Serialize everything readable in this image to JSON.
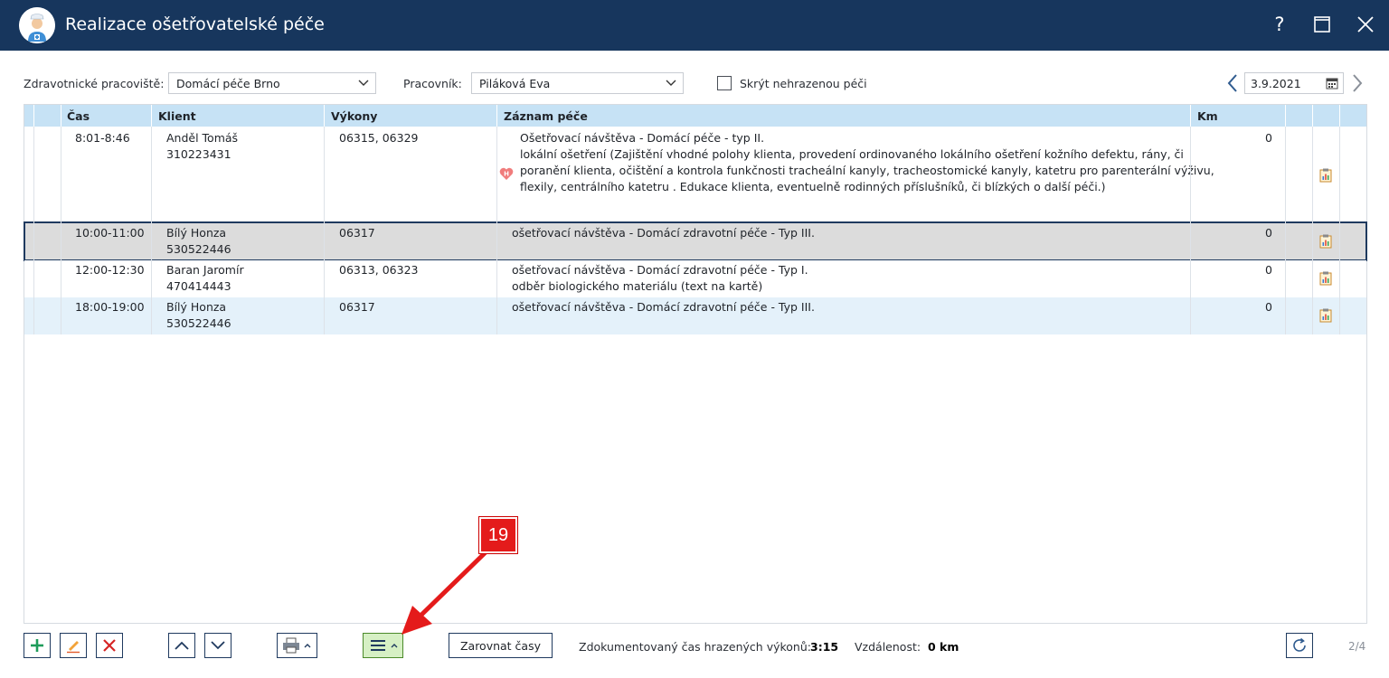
{
  "window": {
    "title": "Realizace ošetřovatelské péče",
    "help": "?"
  },
  "filters": {
    "workplace_label": "Zdravotnické pracoviště:",
    "workplace_value": "Domácí péče Brno",
    "worker_label": "Pracovník:",
    "worker_value": "Piláková Eva",
    "hide_label": "Skrýt nehrazenou péči",
    "hide_checked": false,
    "date": "3.9.2021"
  },
  "grid": {
    "columns": [
      "Čas",
      "Klient",
      "Výkony",
      "Záznam péče",
      "Km"
    ],
    "rows": [
      {
        "time": "8:01-8:46",
        "client_name": "Anděl Tomáš",
        "client_id": "310223431",
        "codes": "06315, 06329",
        "record_lines": [
          "Ošetřovací návštěva - Domácí péče - typ II.",
          "lokální ošetření (Zajištění vhodné polohy klienta, provedení ordinovaného lokálního ošetření kožního defektu, rány, či",
          "poranění klienta, očištění a kontrola funkčnosti tracheální kanyly, tracheostomické kanyly, katetru pro parenterální výživu,",
          "flexily, centrálního katetru . Edukace klienta, eventuelně rodinných příslušníků, či blízkých o další péči.)"
        ],
        "has_h_icon": true,
        "km": "0",
        "state": "normal"
      },
      {
        "time": "10:00-11:00",
        "client_name": "Bílý Honza",
        "client_id": "530522446",
        "codes": "06317",
        "record_lines": [
          "ošetřovací návštěva - Domácí zdravotní péče - Typ III."
        ],
        "has_h_icon": false,
        "km": "0",
        "state": "selected"
      },
      {
        "time": "12:00-12:30",
        "client_name": "Baran Jaromír",
        "client_id": "470414443",
        "codes": "06313, 06323",
        "record_lines": [
          "ošetřovací návštěva - Domácí zdravotní péče - Typ I.",
          "odběr biologického materiálu (text na kartě)"
        ],
        "has_h_icon": false,
        "km": "0",
        "state": "normal"
      },
      {
        "time": "18:00-19:00",
        "client_name": "Bílý Honza",
        "client_id": "530522446",
        "codes": "06317",
        "record_lines": [
          "ošetřovací návštěva - Domácí zdravotní péče - Typ III."
        ],
        "has_h_icon": false,
        "km": "0",
        "state": "alt"
      }
    ]
  },
  "toolbar": {
    "align_times_label": "Zarovnat časy",
    "doc_time_label": "Zdokumentovaný čas hrazených výkonů:",
    "doc_time_value": "3:15",
    "distance_label": "Vzdálenost:",
    "distance_value": "0 km",
    "pager": "2/4"
  },
  "callout": {
    "number": "19"
  },
  "colors": {
    "titlebar": "#17365d",
    "header": "#c6e2f5",
    "selected_row": "#dcdcdc",
    "alt_row": "#e4f1fa",
    "callout": "#e41b1b",
    "green_button": "#d6f0c4"
  }
}
